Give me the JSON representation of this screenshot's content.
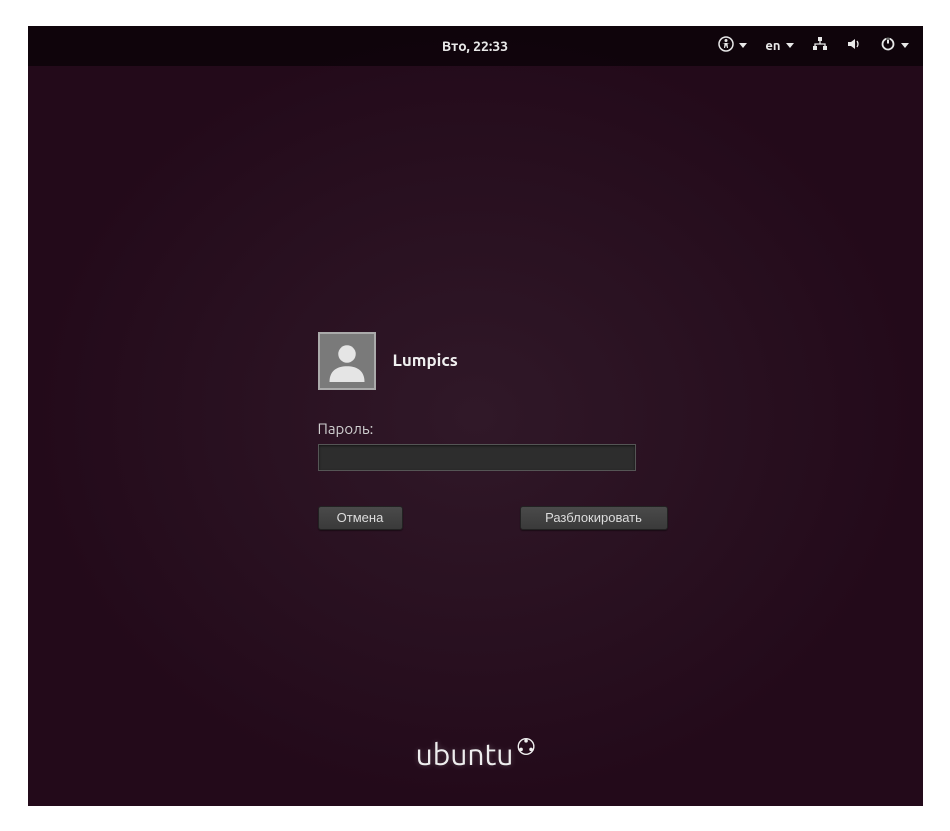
{
  "topbar": {
    "datetime": "Вто, 22:33",
    "language": "en"
  },
  "login": {
    "username": "Lumpics",
    "password_label": "Пароль:",
    "password_value": "",
    "cancel_label": "Отмена",
    "unlock_label": "Разблокировать"
  },
  "branding": {
    "name": "ubuntu"
  },
  "colors": {
    "background": "#2c0a22",
    "panel": "#000000",
    "text": "#e8e8e8"
  }
}
